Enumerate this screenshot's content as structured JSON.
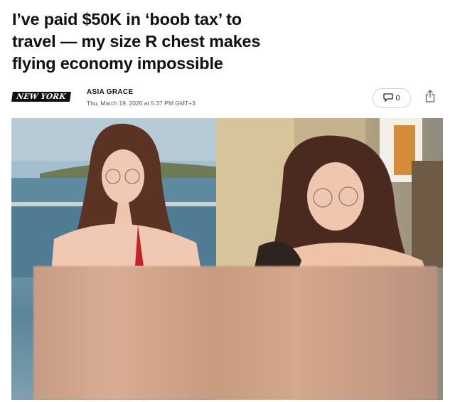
{
  "article": {
    "headline": "I’ve paid $50K in ‘boob tax’ to travel — my size R chest makes flying economy impossible",
    "publication": "NEW YORK POST",
    "author": "ASIA GRACE",
    "date": "Thu, March 19, 2026 at 5:37 PM GMT+3",
    "comment_count": "0"
  },
  "icons": {
    "comment": "comment-bubble-icon",
    "share": "share-icon"
  },
  "photos": {
    "left_alt": "woman-on-balcony-photo",
    "right_alt": "woman-in-restaurant-photo"
  },
  "colors": {
    "headline": "#111111",
    "date": "#555555",
    "logo_bg": "#111111"
  }
}
